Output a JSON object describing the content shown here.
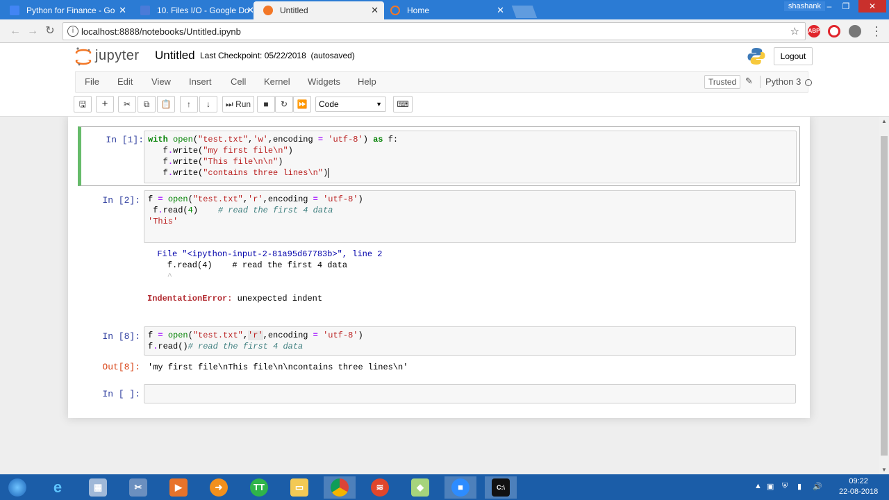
{
  "browser": {
    "tabs": [
      {
        "title": "Python for Finance - Go",
        "icon_color": "#4285f4"
      },
      {
        "title": "10. Files I/O - Google Do",
        "icon_color": "#4a7bd8"
      },
      {
        "title": "Untitled",
        "icon_color": "#f37726"
      },
      {
        "title": "Home",
        "icon_color": "#f37726"
      }
    ],
    "user": "shashank",
    "url": "localhost:8888/notebooks/Untitled.ipynb"
  },
  "jupyter": {
    "logo_text": "jupyter",
    "notebook_title": "Untitled",
    "checkpoint": "Last Checkpoint: 05/22/2018",
    "save_status": "(autosaved)",
    "logout_label": "Logout",
    "menu": [
      "File",
      "Edit",
      "View",
      "Insert",
      "Cell",
      "Kernel",
      "Widgets",
      "Help"
    ],
    "trusted_label": "Trusted",
    "kernel_name": "Python 3",
    "run_label": "Run",
    "cell_type": "Code"
  },
  "cells": [
    {
      "prompt": "In [1]:",
      "lines": [
        "with open(\"test.txt\",'w',encoding = 'utf-8') as f:",
        "   f.write(\"my first file\\n\")",
        "   f.write(\"This file\\n\\n\")",
        "   f.write(\"contains three lines\\n\")"
      ]
    },
    {
      "prompt": "In [2]:",
      "lines": [
        "f = open(\"test.txt\",'r',encoding = 'utf-8')",
        " f.read(4)    # read the first 4 data",
        "'This'"
      ],
      "error_lines": [
        "  File \"<ipython-input-2-81a95d67783b>\", line 2",
        "    f.read(4)    # read the first 4 data",
        "    ^"
      ],
      "error_name": "IndentationError:",
      "error_msg": " unexpected indent"
    },
    {
      "prompt": "In [8]:",
      "lines": [
        "f = open(\"test.txt\",'r',encoding = 'utf-8')",
        "f.read()# read the first 4 data"
      ],
      "out_prompt": "Out[8]:",
      "output": "'my first file\\nThis file\\n\\ncontains three lines\\n'"
    },
    {
      "prompt": "In [ ]:"
    }
  ],
  "taskbar": {
    "time": "09:22",
    "date": "22-08-2018"
  }
}
